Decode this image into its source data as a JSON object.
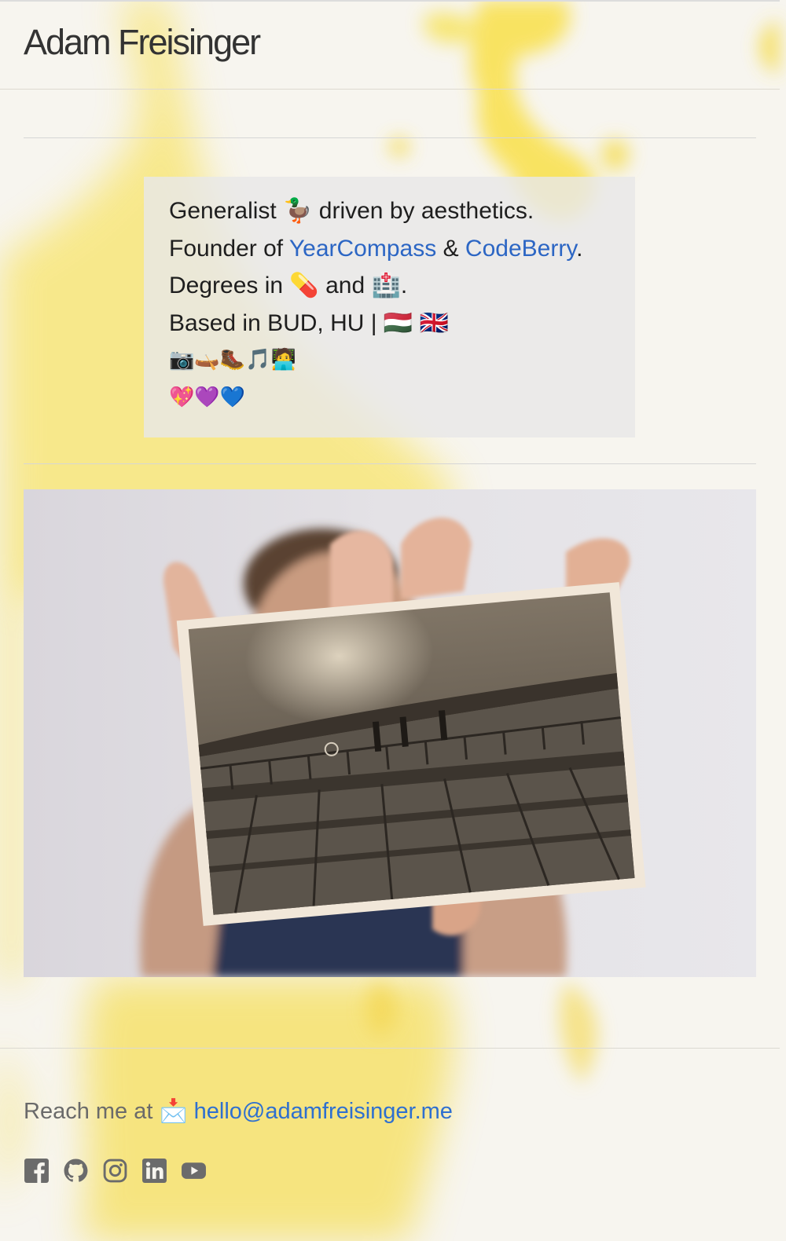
{
  "header": {
    "title": "Adam Freisinger"
  },
  "bio": {
    "line1": {
      "text_a": "Generalist",
      "emoji": "🦆",
      "text_b": "driven by aesthetics."
    },
    "line2": {
      "prefix": "Founder of",
      "link1": "YearCompass",
      "sep": "&",
      "link2": "CodeBerry",
      "suffix": "."
    },
    "line3": {
      "prefix": "Degrees in",
      "emoji1": "💊",
      "mid": "and",
      "emoji2": "🏥",
      "suffix": "."
    },
    "line4": {
      "text": "Based in BUD, HU |",
      "flags": "🇭🇺 🇬🇧"
    },
    "hobbies": "📷🛶🥾🎵🧑‍💻",
    "hearts": "💖💜💙"
  },
  "contact": {
    "label": "Reach me at",
    "emoji": "📩",
    "email": "hello@adamfreisinger.me"
  },
  "socials": [
    {
      "name": "facebook-icon"
    },
    {
      "name": "github-icon"
    },
    {
      "name": "instagram-icon"
    },
    {
      "name": "linkedin-icon"
    },
    {
      "name": "youtube-icon"
    }
  ],
  "colors": {
    "accent": "#2c66c4",
    "background": "#f7f5ef",
    "watercolor": "#f7e25a",
    "icon": "#6b6b6b"
  }
}
